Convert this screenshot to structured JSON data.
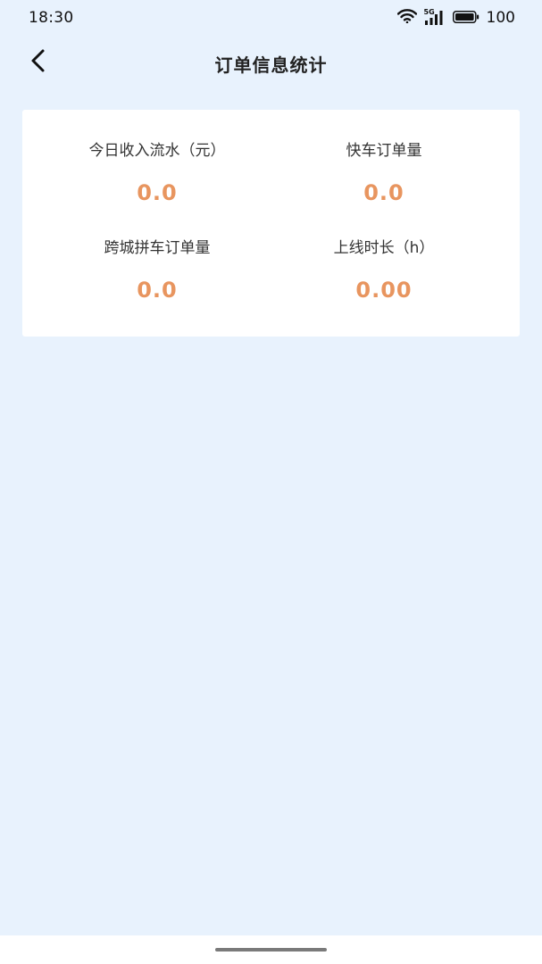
{
  "status_bar": {
    "time": "18:30",
    "network_label": "5G",
    "battery": "100",
    "icons": [
      "wifi-icon",
      "signal-icon",
      "battery-icon"
    ]
  },
  "header": {
    "title": "订单信息统计",
    "back_icon": "chevron-left-icon"
  },
  "stats": {
    "today_income_label": "今日收入流水（元）",
    "today_income_value": "0.0",
    "express_orders_label": "快车订单量",
    "express_orders_value": "0.0",
    "intercity_orders_label": "跨城拼车订单量",
    "intercity_orders_value": "0.0",
    "online_hours_label": "上线时长（h）",
    "online_hours_value": "0.00"
  },
  "colors": {
    "background": "#e8f2fd",
    "card": "#ffffff",
    "value_accent": "#e8955f",
    "title_text": "#222222"
  }
}
